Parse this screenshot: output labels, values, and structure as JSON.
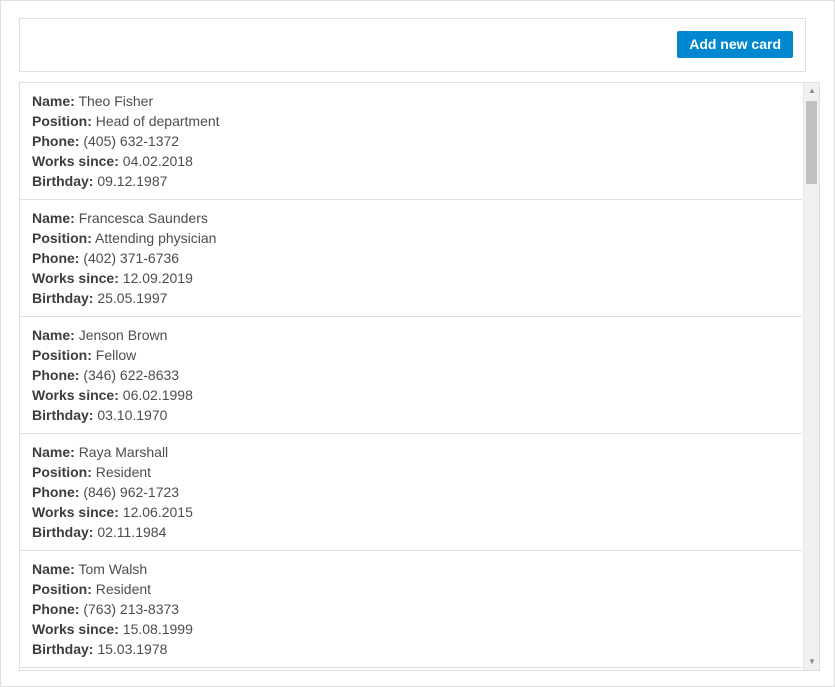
{
  "toolbar": {
    "add_button_label": "Add new card"
  },
  "labels": {
    "name": "Name:",
    "position": "Position:",
    "phone": "Phone:",
    "works_since": "Works since:",
    "birthday": "Birthday:"
  },
  "cards": [
    {
      "name": "Theo Fisher",
      "position": "Head of department",
      "phone": "(405) 632-1372",
      "works_since": "04.02.2018",
      "birthday": "09.12.1987"
    },
    {
      "name": "Francesca Saunders",
      "position": "Attending physician",
      "phone": "(402) 371-6736",
      "works_since": "12.09.2019",
      "birthday": "25.05.1997"
    },
    {
      "name": "Jenson Brown",
      "position": "Fellow",
      "phone": "(346) 622-8633",
      "works_since": "06.02.1998",
      "birthday": "03.10.1970"
    },
    {
      "name": "Raya Marshall",
      "position": "Resident",
      "phone": "(846) 962-1723",
      "works_since": "12.06.2015",
      "birthday": "02.11.1984"
    },
    {
      "name": "Tom Walsh",
      "position": "Resident",
      "phone": "(763) 213-8373",
      "works_since": "15.08.1999",
      "birthday": "15.03.1978"
    }
  ],
  "scrollbar": {
    "up_icon": "arrow-up-icon",
    "down_icon": "arrow-down-icon",
    "scroll_fraction": 0.0
  }
}
